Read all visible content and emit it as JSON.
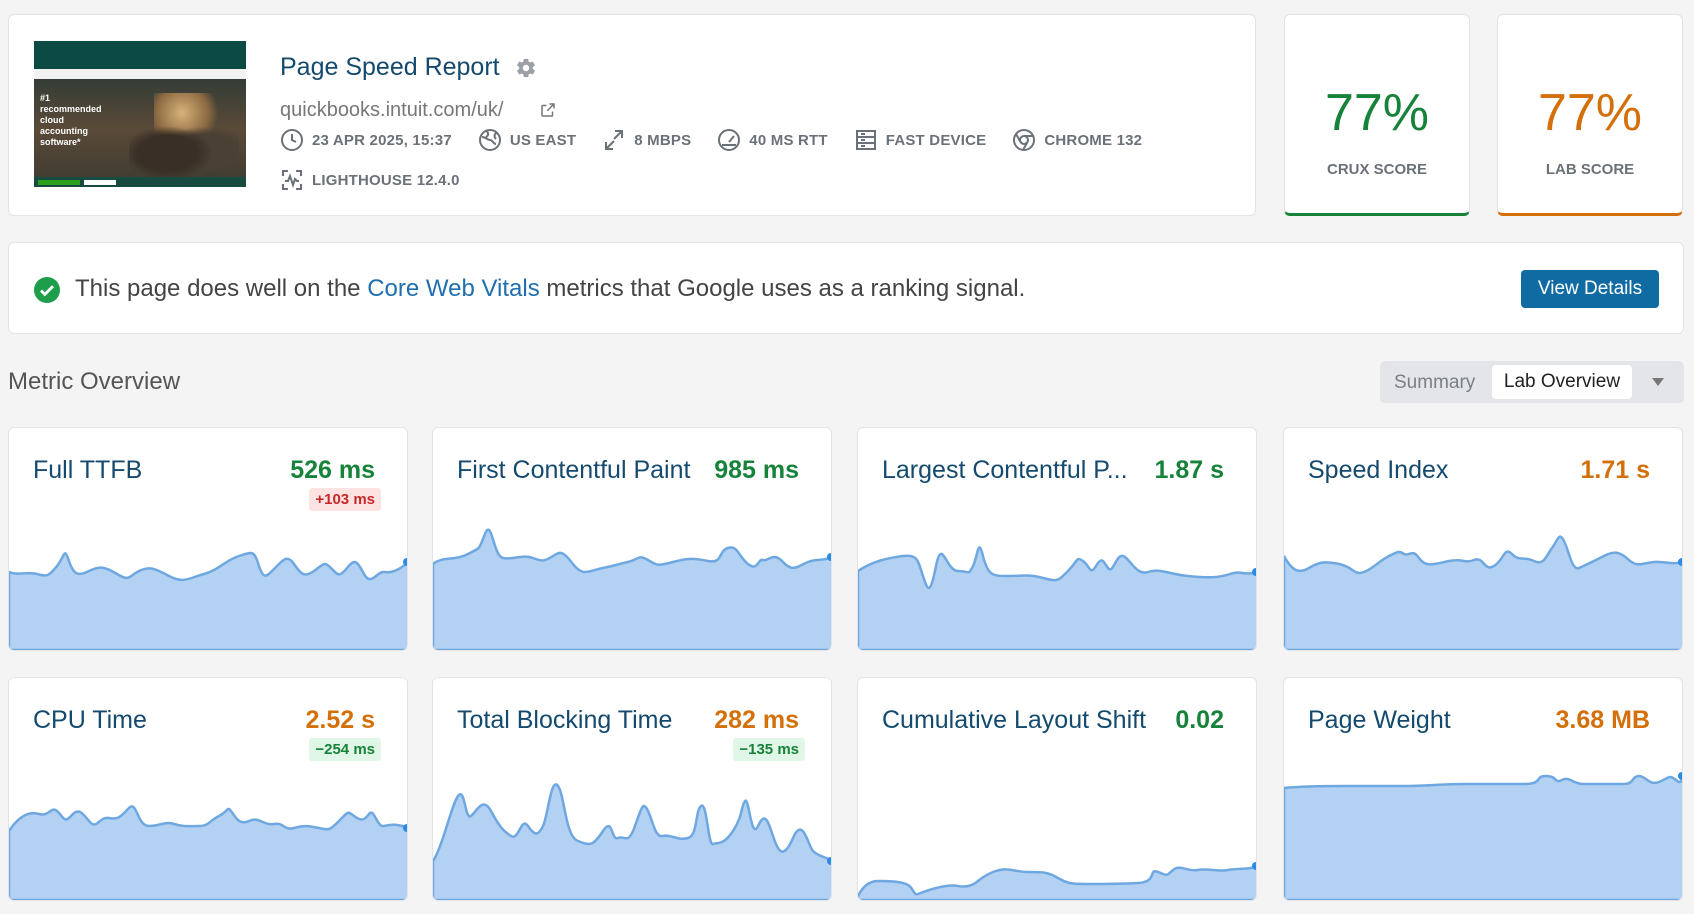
{
  "header": {
    "title": "Page Speed Report",
    "url": "quickbooks.intuit.com/uk/",
    "thumbnail_text": "#1 recommended cloud accounting software*",
    "meta": [
      {
        "icon": "clock-icon",
        "label": "23 APR 2025, 15:37"
      },
      {
        "icon": "globe-icon",
        "label": "US EAST"
      },
      {
        "icon": "bandwidth-icon",
        "label": "8 MBPS"
      },
      {
        "icon": "latency-gauge-icon",
        "label": "40 MS RTT"
      },
      {
        "icon": "device-icon",
        "label": "FAST DEVICE"
      },
      {
        "icon": "chrome-icon",
        "label": "CHROME 132"
      },
      {
        "icon": "lighthouse-icon",
        "label": "LIGHTHOUSE 12.4.0"
      }
    ]
  },
  "scores": {
    "crux": {
      "value": "77%",
      "label": "CRUX SCORE",
      "color": "#178239"
    },
    "lab": {
      "value": "77%",
      "label": "LAB SCORE",
      "color": "#d4700a"
    }
  },
  "banner": {
    "text_before": "This page does well on the ",
    "link": "Core Web Vitals",
    "text_after": " metrics that Google uses as a ranking signal.",
    "button": "View Details"
  },
  "overview": {
    "title": "Metric Overview",
    "toggle_options": [
      "Summary",
      "Lab Overview"
    ],
    "selected": "Lab Overview"
  },
  "metrics": [
    {
      "name": "Full TTFB",
      "value": "526 ms",
      "status": "good",
      "delta": "+103 ms",
      "delta_type": "bad"
    },
    {
      "name": "First Contentful Paint",
      "value": "985 ms",
      "status": "good",
      "delta": "",
      "delta_type": ""
    },
    {
      "name": "Largest Contentful P...",
      "value": "1.87 s",
      "status": "good",
      "delta": "",
      "delta_type": ""
    },
    {
      "name": "Speed Index",
      "value": "1.71 s",
      "status": "average",
      "delta": "",
      "delta_type": ""
    },
    {
      "name": "CPU Time",
      "value": "2.52 s",
      "status": "average",
      "delta": "−254 ms",
      "delta_type": "good"
    },
    {
      "name": "Total Blocking Time",
      "value": "282 ms",
      "status": "average",
      "delta": "−135 ms",
      "delta_type": "good"
    },
    {
      "name": "Cumulative Layout Shift",
      "value": "0.02",
      "status": "good",
      "delta": "",
      "delta_type": ""
    },
    {
      "name": "Page Weight",
      "value": "3.68 MB",
      "status": "average",
      "delta": "",
      "delta_type": ""
    }
  ],
  "colors": {
    "good": "#178239",
    "average": "#d4700a",
    "accent": "#106ba3",
    "spark_fill": "#b3d1f3",
    "spark_line": "#6fa8e0"
  }
}
